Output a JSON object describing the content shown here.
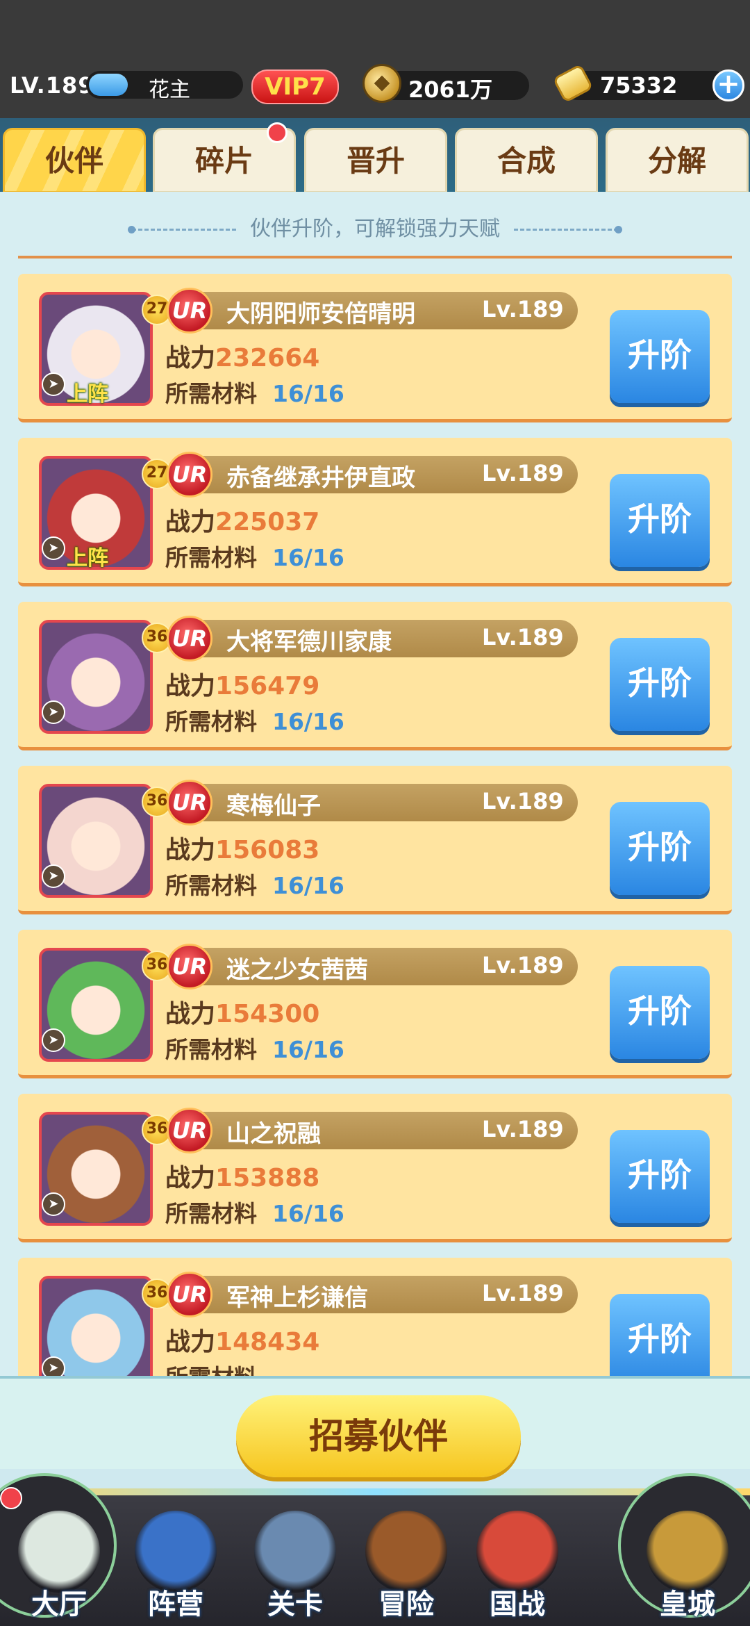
{
  "header": {
    "level": "LV.189",
    "player_name": "花主",
    "vip": "VIP7",
    "coins": "2061万",
    "gold": "75332",
    "plus_icon": "plus-icon"
  },
  "tabs": [
    {
      "label": "伙伴",
      "active": true
    },
    {
      "label": "碎片",
      "badge": true
    },
    {
      "label": "晋升"
    },
    {
      "label": "合成"
    },
    {
      "label": "分解"
    }
  ],
  "hint": "伙伴升阶，可解锁强力天赋",
  "labels": {
    "power": "战力",
    "materials": "所需材料",
    "upgrade": "升阶",
    "rarity": "UR",
    "onstage": "上阵"
  },
  "heroes": [
    {
      "badge": "27",
      "name": "大阴阳师安倍晴明",
      "level": "Lv.189",
      "power": "232664",
      "materials": "16/16",
      "onstage": true,
      "color": "#eae6f0"
    },
    {
      "badge": "27",
      "name": "赤备继承井伊直政",
      "level": "Lv.189",
      "power": "225037",
      "materials": "16/16",
      "onstage": true,
      "color": "#c03a3a"
    },
    {
      "badge": "36",
      "name": "大将军德川家康",
      "level": "Lv.189",
      "power": "156479",
      "materials": "16/16",
      "onstage": false,
      "color": "#9a6ab0"
    },
    {
      "badge": "36",
      "name": "寒梅仙子",
      "level": "Lv.189",
      "power": "156083",
      "materials": "16/16",
      "onstage": false,
      "color": "#f4d6cf"
    },
    {
      "badge": "36",
      "name": "迷之少女茜茜",
      "level": "Lv.189",
      "power": "154300",
      "materials": "16/16",
      "onstage": false,
      "color": "#5fb85a"
    },
    {
      "badge": "36",
      "name": "山之祝融",
      "level": "Lv.189",
      "power": "153888",
      "materials": "16/16",
      "onstage": false,
      "color": "#a0603a"
    },
    {
      "badge": "36",
      "name": "军神上杉谦信",
      "level": "Lv.189",
      "power": "148434",
      "materials": "",
      "onstage": false,
      "color": "#8fc8ea"
    }
  ],
  "recruit_button": "招募伙伴",
  "nav": [
    {
      "label": "大厅",
      "icon": "castle-icon"
    },
    {
      "label": "阵营",
      "icon": "map-scroll-icon"
    },
    {
      "label": "关卡",
      "icon": "crossed-swords-icon"
    },
    {
      "label": "冒险",
      "icon": "ship-icon"
    },
    {
      "label": "国战",
      "icon": "war-flags-icon"
    },
    {
      "label": "皇城",
      "icon": "palace-icon"
    }
  ]
}
